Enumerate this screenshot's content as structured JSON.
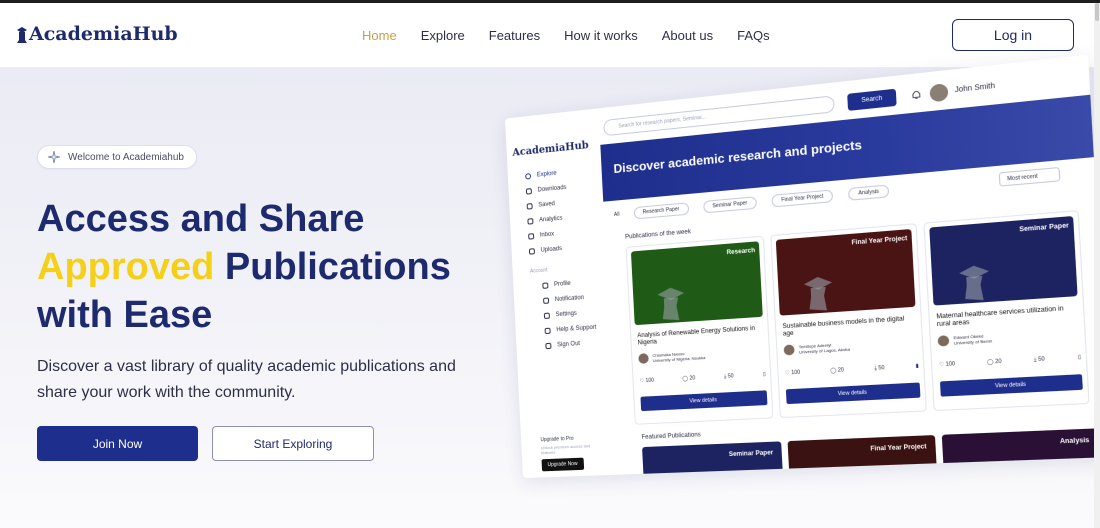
{
  "nav": {
    "logo": "AcademiaHub",
    "links": [
      {
        "label": "Home",
        "active": true
      },
      {
        "label": "Explore"
      },
      {
        "label": "Features"
      },
      {
        "label": "How it works"
      },
      {
        "label": "About us"
      },
      {
        "label": "FAQs"
      }
    ],
    "login_label": "Log in"
  },
  "hero": {
    "badge": "Welcome to Academiahub",
    "title_line1": "Access and Share",
    "title_highlight": "Approved",
    "title_line2_rest": "Publications",
    "title_line3": "with Ease",
    "description": "Discover a vast library of quality academic publications and share your work with the community.",
    "primary_cta": "Join Now",
    "secondary_cta": "Start Exploring"
  },
  "colors": {
    "brand": "#1e2a6e",
    "primary": "#1e2e8c",
    "highlight": "#f5d019",
    "nav_active": "#c8a04a"
  },
  "mockup": {
    "logo": "AcademiaHub",
    "search_placeholder": "Search for research papers, Seminar...",
    "search_button": "Search",
    "user_name": "John Smith",
    "banner_title": "Discover academic research and  projects",
    "sidebar": [
      {
        "label": "Explore",
        "active": true,
        "icon": "compass-icon"
      },
      {
        "label": "Downloads",
        "icon": "download-icon"
      },
      {
        "label": "Saved",
        "icon": "bookmark-icon"
      },
      {
        "label": "Analytics",
        "icon": "chart-icon"
      },
      {
        "label": "Inbox",
        "icon": "mail-icon"
      },
      {
        "label": "Uploads",
        "icon": "upload-icon"
      }
    ],
    "account_section": "Account",
    "account_items": [
      {
        "label": "Profile",
        "icon": "user-icon"
      },
      {
        "label": "Notification",
        "icon": "bell-icon"
      },
      {
        "label": "Settings",
        "icon": "gear-icon"
      },
      {
        "label": "Help & Support",
        "icon": "headset-icon"
      },
      {
        "label": "Sign Out",
        "icon": "logout-icon"
      }
    ],
    "upgrade": {
      "title": "Upgrade to Pro",
      "note": "Unlock premium access and features",
      "button": "Upgrade Now"
    },
    "filters": [
      "All",
      "Research Paper",
      "Seminar Paper",
      "Final Year Project",
      "Analysis"
    ],
    "sort": "Most recent",
    "section_week": "Publications of the week",
    "section_featured": "Featured Publications",
    "cards": [
      {
        "tag": "Research",
        "color": "#1f5a16",
        "title": "Analysis of Renewable Energy Solutions in Nigeria",
        "author": "Chiamaka Nwosu",
        "institution": "University of Nigeria, Nsukka",
        "likes": "100",
        "comments": "20",
        "downloads": "50",
        "button": "View details"
      },
      {
        "tag": "Final Year Project",
        "color": "#4a1414",
        "title": "Sustainable business models in the digital age",
        "author": "Temitope Adeniyi",
        "institution": "University of Lagos, Akoka",
        "likes": "100",
        "comments": "20",
        "downloads": "50",
        "button": "View details"
      },
      {
        "tag": "Seminar Paper",
        "color": "#1c2360",
        "title": "Maternal healthcare services utilization in rural areas",
        "author": "Edward Okeke",
        "institution": "University of Benin",
        "likes": "100",
        "comments": "20",
        "downloads": "50",
        "button": "View details"
      }
    ],
    "featured": [
      {
        "tag": "Seminar Paper",
        "color": "#1c2360"
      },
      {
        "tag": "Final Year Project",
        "color": "#3a1212"
      },
      {
        "tag": "Analysis",
        "color": "#2a1035"
      }
    ]
  }
}
